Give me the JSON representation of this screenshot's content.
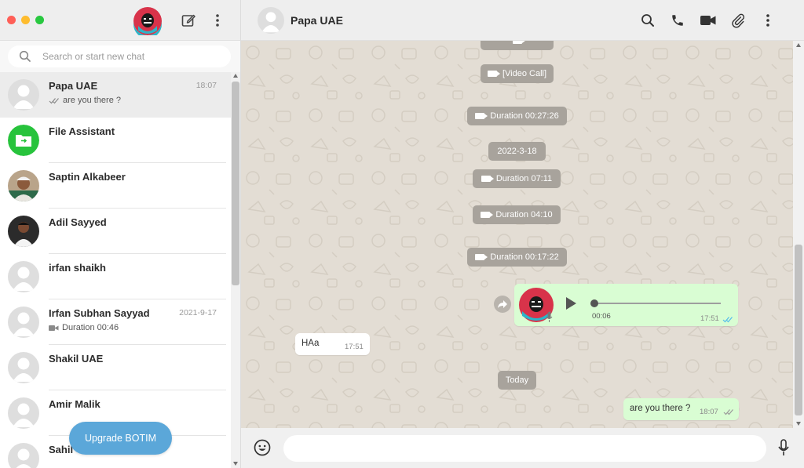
{
  "sidebar": {
    "search": {
      "placeholder": "Search or start new chat"
    },
    "chats": [
      {
        "name": "Papa UAE",
        "time": "18:07",
        "preview": "are you there ?",
        "preview_icon": "double-check-icon",
        "avatar": "default-person",
        "active": true
      },
      {
        "name": "File Assistant",
        "time": "",
        "preview": "",
        "avatar": "file-assistant-green"
      },
      {
        "name": "Saptin Alkabeer",
        "time": "",
        "preview": "",
        "avatar": "photo"
      },
      {
        "name": "Adil Sayyed",
        "time": "",
        "preview": "",
        "avatar": "photo"
      },
      {
        "name": "irfan shaikh",
        "time": "",
        "preview": "",
        "avatar": "default-person"
      },
      {
        "name": "Irfan Subhan Sayyad",
        "time": "2021-9-17",
        "preview": "Duration 00:46",
        "preview_icon": "video-camera-icon",
        "avatar": "default-person"
      },
      {
        "name": "Shakil UAE",
        "time": "",
        "preview": "",
        "avatar": "default-person"
      },
      {
        "name": "Amir Malik",
        "time": "",
        "preview": "",
        "avatar": "default-person"
      },
      {
        "name": "Sahil",
        "time": "",
        "preview": "",
        "avatar": "default-person"
      }
    ],
    "upgrade_label": "Upgrade BOTIM"
  },
  "conversation": {
    "contact_name": "Papa UAE",
    "messages": {
      "sys_video_call": "[Video Call]",
      "sys_dur_1": "Duration 00:27:26",
      "sys_date": "2022-3-18",
      "sys_dur_2": "Duration 07:11",
      "sys_dur_3": "Duration 04:10",
      "sys_dur_4": "Duration 00:17:22",
      "voice_duration": "00:06",
      "voice_time": "17:51",
      "in_text": "HAa",
      "in_time": "17:51",
      "sys_today": "Today",
      "out_text": "are you there ?",
      "out_time": "18:07"
    },
    "input_placeholder": ""
  },
  "colors": {
    "chat_background": "#e3ddd4",
    "outgoing_bubble": "#d9fdd3",
    "system_pill": "#a8a39c",
    "upgrade_button": "#5ba7d9",
    "check_blue": "#53bdeb",
    "file_assistant_green": "#27c33c"
  }
}
